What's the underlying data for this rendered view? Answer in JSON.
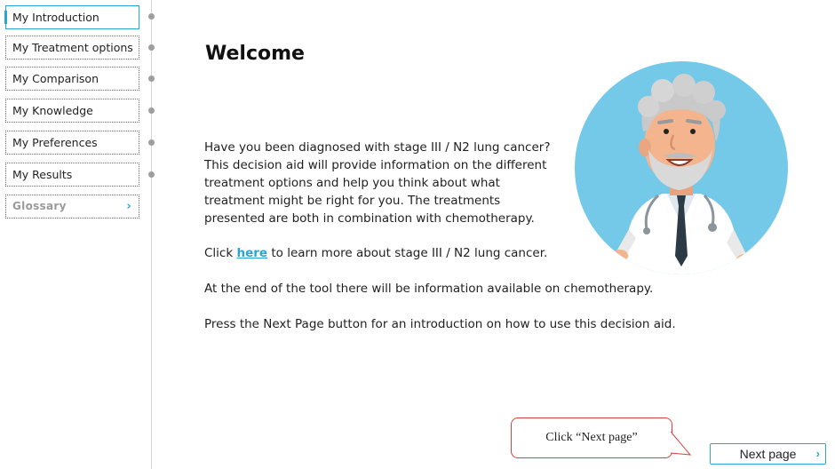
{
  "sidebar": {
    "items": [
      {
        "label": "My Introduction"
      },
      {
        "label": "My Treatment options"
      },
      {
        "label": "My Comparison"
      },
      {
        "label": "My Knowledge"
      },
      {
        "label": "My Preferences"
      },
      {
        "label": "My Results"
      }
    ],
    "glossary": {
      "label": "Glossary",
      "icon": "chevron-right-icon"
    }
  },
  "main": {
    "title": "Welcome",
    "intro": "Have you been diagnosed with stage III / N2 lung cancer? This decision aid will provide information on the different treatment options and help you think about what treatment might be right for you. The treatments presented are both in combination with chemotherapy.",
    "link_line": {
      "prefix": "Click ",
      "link_text": "here",
      "suffix": " to learn more about stage III / N2 lung cancer."
    },
    "chemo_line": "At the end of the tool there will be information available on chemotherapy.",
    "next_line": "Press the Next Page button for an introduction on how to use this decision aid."
  },
  "callout": {
    "text": "Click “Next page”"
  },
  "next_button": {
    "label": "Next page",
    "icon": "chevron-right-icon"
  },
  "colors": {
    "accent": "#2aa5d6",
    "callout_border": "#d94040",
    "illustration_bg": "#74c9e8"
  }
}
